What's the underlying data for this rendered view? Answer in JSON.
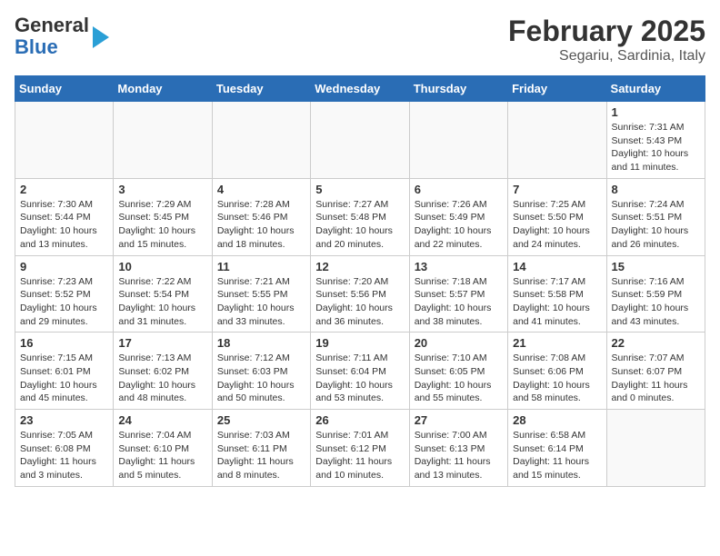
{
  "header": {
    "logo_general": "General",
    "logo_blue": "Blue",
    "title": "February 2025",
    "subtitle": "Segariu, Sardinia, Italy"
  },
  "weekdays": [
    "Sunday",
    "Monday",
    "Tuesday",
    "Wednesday",
    "Thursday",
    "Friday",
    "Saturday"
  ],
  "weeks": [
    [
      {
        "day": "",
        "info": ""
      },
      {
        "day": "",
        "info": ""
      },
      {
        "day": "",
        "info": ""
      },
      {
        "day": "",
        "info": ""
      },
      {
        "day": "",
        "info": ""
      },
      {
        "day": "",
        "info": ""
      },
      {
        "day": "1",
        "info": "Sunrise: 7:31 AM\nSunset: 5:43 PM\nDaylight: 10 hours\nand 11 minutes."
      }
    ],
    [
      {
        "day": "2",
        "info": "Sunrise: 7:30 AM\nSunset: 5:44 PM\nDaylight: 10 hours\nand 13 minutes."
      },
      {
        "day": "3",
        "info": "Sunrise: 7:29 AM\nSunset: 5:45 PM\nDaylight: 10 hours\nand 15 minutes."
      },
      {
        "day": "4",
        "info": "Sunrise: 7:28 AM\nSunset: 5:46 PM\nDaylight: 10 hours\nand 18 minutes."
      },
      {
        "day": "5",
        "info": "Sunrise: 7:27 AM\nSunset: 5:48 PM\nDaylight: 10 hours\nand 20 minutes."
      },
      {
        "day": "6",
        "info": "Sunrise: 7:26 AM\nSunset: 5:49 PM\nDaylight: 10 hours\nand 22 minutes."
      },
      {
        "day": "7",
        "info": "Sunrise: 7:25 AM\nSunset: 5:50 PM\nDaylight: 10 hours\nand 24 minutes."
      },
      {
        "day": "8",
        "info": "Sunrise: 7:24 AM\nSunset: 5:51 PM\nDaylight: 10 hours\nand 26 minutes."
      }
    ],
    [
      {
        "day": "9",
        "info": "Sunrise: 7:23 AM\nSunset: 5:52 PM\nDaylight: 10 hours\nand 29 minutes."
      },
      {
        "day": "10",
        "info": "Sunrise: 7:22 AM\nSunset: 5:54 PM\nDaylight: 10 hours\nand 31 minutes."
      },
      {
        "day": "11",
        "info": "Sunrise: 7:21 AM\nSunset: 5:55 PM\nDaylight: 10 hours\nand 33 minutes."
      },
      {
        "day": "12",
        "info": "Sunrise: 7:20 AM\nSunset: 5:56 PM\nDaylight: 10 hours\nand 36 minutes."
      },
      {
        "day": "13",
        "info": "Sunrise: 7:18 AM\nSunset: 5:57 PM\nDaylight: 10 hours\nand 38 minutes."
      },
      {
        "day": "14",
        "info": "Sunrise: 7:17 AM\nSunset: 5:58 PM\nDaylight: 10 hours\nand 41 minutes."
      },
      {
        "day": "15",
        "info": "Sunrise: 7:16 AM\nSunset: 5:59 PM\nDaylight: 10 hours\nand 43 minutes."
      }
    ],
    [
      {
        "day": "16",
        "info": "Sunrise: 7:15 AM\nSunset: 6:01 PM\nDaylight: 10 hours\nand 45 minutes."
      },
      {
        "day": "17",
        "info": "Sunrise: 7:13 AM\nSunset: 6:02 PM\nDaylight: 10 hours\nand 48 minutes."
      },
      {
        "day": "18",
        "info": "Sunrise: 7:12 AM\nSunset: 6:03 PM\nDaylight: 10 hours\nand 50 minutes."
      },
      {
        "day": "19",
        "info": "Sunrise: 7:11 AM\nSunset: 6:04 PM\nDaylight: 10 hours\nand 53 minutes."
      },
      {
        "day": "20",
        "info": "Sunrise: 7:10 AM\nSunset: 6:05 PM\nDaylight: 10 hours\nand 55 minutes."
      },
      {
        "day": "21",
        "info": "Sunrise: 7:08 AM\nSunset: 6:06 PM\nDaylight: 10 hours\nand 58 minutes."
      },
      {
        "day": "22",
        "info": "Sunrise: 7:07 AM\nSunset: 6:07 PM\nDaylight: 11 hours\nand 0 minutes."
      }
    ],
    [
      {
        "day": "23",
        "info": "Sunrise: 7:05 AM\nSunset: 6:08 PM\nDaylight: 11 hours\nand 3 minutes."
      },
      {
        "day": "24",
        "info": "Sunrise: 7:04 AM\nSunset: 6:10 PM\nDaylight: 11 hours\nand 5 minutes."
      },
      {
        "day": "25",
        "info": "Sunrise: 7:03 AM\nSunset: 6:11 PM\nDaylight: 11 hours\nand 8 minutes."
      },
      {
        "day": "26",
        "info": "Sunrise: 7:01 AM\nSunset: 6:12 PM\nDaylight: 11 hours\nand 10 minutes."
      },
      {
        "day": "27",
        "info": "Sunrise: 7:00 AM\nSunset: 6:13 PM\nDaylight: 11 hours\nand 13 minutes."
      },
      {
        "day": "28",
        "info": "Sunrise: 6:58 AM\nSunset: 6:14 PM\nDaylight: 11 hours\nand 15 minutes."
      },
      {
        "day": "",
        "info": ""
      }
    ]
  ]
}
